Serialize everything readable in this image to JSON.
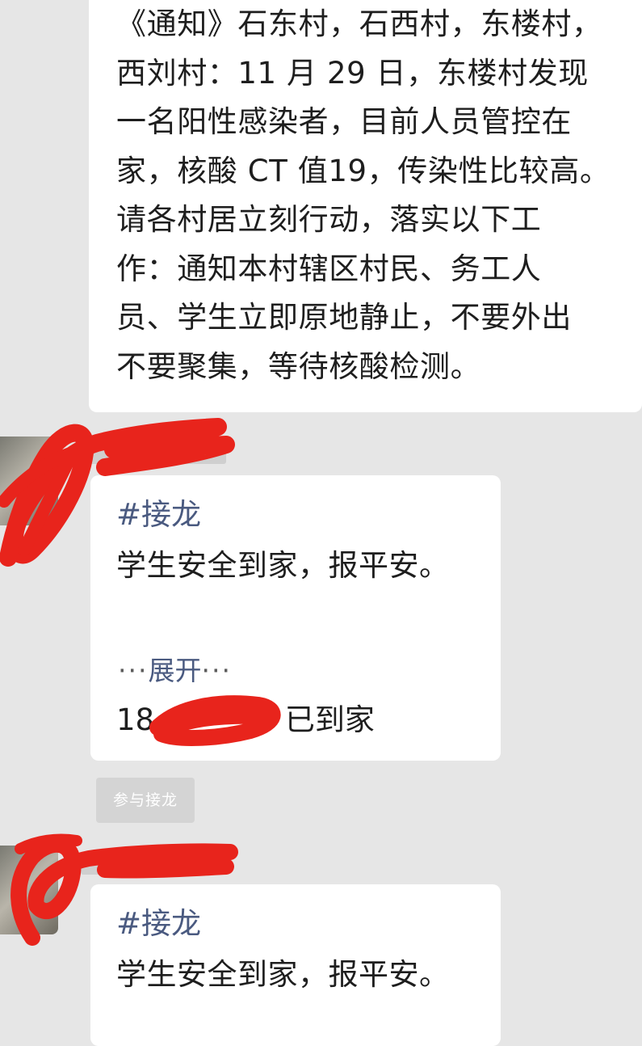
{
  "notice_message": {
    "text": "《通知》石东村，石西村，东楼村，\n西刘村：11 月 29 日，东楼村发现\n一名阳性感染者，目前人员管控在\n家，核酸 CT 值19，传染性比较高。\n请各村居立刻行动，落实以下工\n作：通知本村辖区村民、务工人\n员、学生立即原地静止，不要外出\n不要聚集，等待核酸检测。"
  },
  "jielong_1": {
    "hashtag": "#接龙",
    "body": "学生安全到家，报平安。",
    "expand_dots_left": "···",
    "expand_label": "展开",
    "expand_dots_right": "···",
    "entry_number": "18.",
    "entry_suffix": "已到家"
  },
  "participate_button": {
    "label": "参与接龙"
  },
  "jielong_2": {
    "hashtag": "#接龙",
    "body": "学生安全到家，报平安。"
  },
  "colors": {
    "background": "#e6e6e6",
    "bubble": "#ffffff",
    "link": "#4a5a80",
    "redaction": "#e8241c"
  }
}
